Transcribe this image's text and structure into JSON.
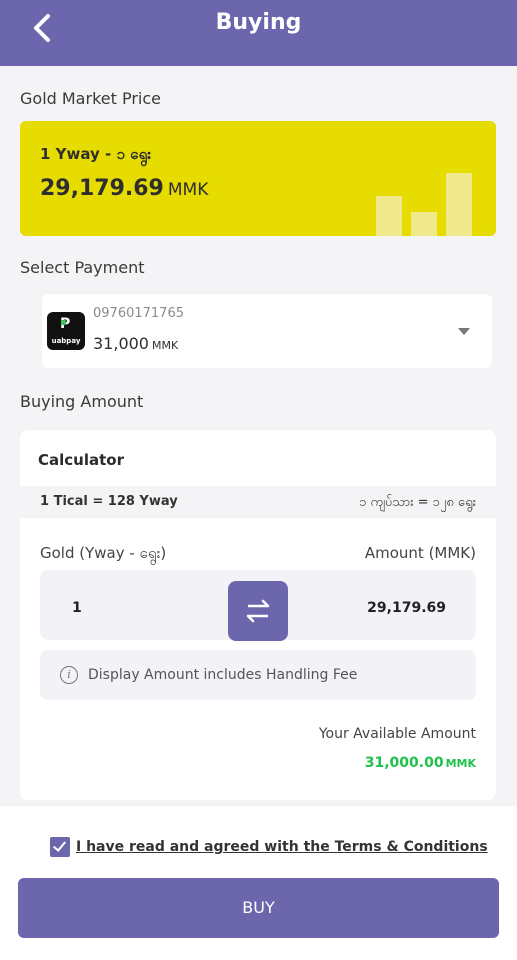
{
  "header": {
    "title": "Buying",
    "back_icon": "chevron-left-icon"
  },
  "market": {
    "label": "Gold Market Price",
    "unit": "1 Yway - ၁ ရွေး",
    "price": "29,179.69",
    "currency": "MMK",
    "card_color": "#e6dc00"
  },
  "payment": {
    "label": "Select Payment",
    "wallet_name": "uabpay",
    "phone": "09760171765",
    "balance": "31,000",
    "currency": "MMK"
  },
  "calculator": {
    "section_label": "Buying Amount",
    "title": "Calculator",
    "ratio_left": "1 Tical = 128 Yway",
    "ratio_right": "၁ ကျပ်သား = ၁၂၈ ရွေး",
    "gold_label": "Gold (Yway - ရွေး)",
    "amount_label": "Amount (MMK)",
    "gold_value": "1",
    "amount_value": "29,179.69",
    "note": "Display Amount includes Handling Fee",
    "available_label": "Your Available Amount",
    "available_value": "31,000.00",
    "available_currency": "MMK"
  },
  "footer": {
    "terms": "I have read and agreed with the Terms & Conditions",
    "terms_checked": true,
    "buy_label": "BUY"
  },
  "colors": {
    "primary": "#6c66ad",
    "accent_green": "#1ec24a",
    "gold": "#e6dc00"
  }
}
